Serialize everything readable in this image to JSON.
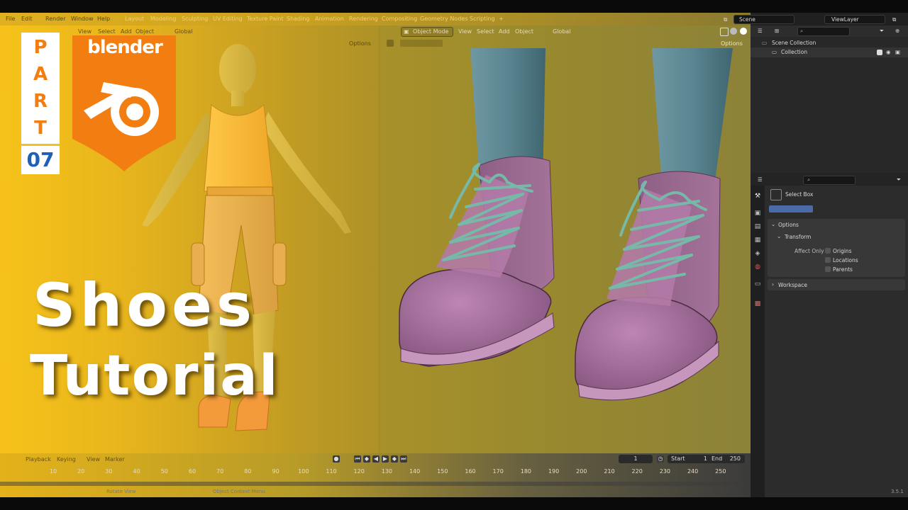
{
  "topbar": {
    "workspaces": [
      "Layout",
      "Modeling",
      "Sculpting",
      "UV Editing",
      "Texture Paint",
      "Shading",
      "Animation",
      "Rendering",
      "Compositing",
      "Geometry Nodes",
      "Scripting"
    ],
    "add_tab": "+",
    "menus_left": [
      "File",
      "Edit",
      "Render",
      "Window",
      "Help"
    ],
    "scene": "Scene",
    "view_layer": "ViewLayer"
  },
  "left_viewport": {
    "menus": [
      "View",
      "Select",
      "Add",
      "Object"
    ],
    "orientation": "Global",
    "options": "Options"
  },
  "right_viewport": {
    "mode": "Object Mode",
    "menus": [
      "View",
      "Select",
      "Add",
      "Object"
    ],
    "orientation": "Global",
    "options": "Options"
  },
  "thumbnail": {
    "part_letters": [
      "P",
      "A",
      "R",
      "T"
    ],
    "part_number": "07",
    "logo_text": "blender",
    "title_line1": "Shoes",
    "title_line2": "Tutorial"
  },
  "outliner": {
    "root": "Scene Collection",
    "items": [
      {
        "label": "Collection"
      }
    ]
  },
  "properties": {
    "tool_name": "Select Box",
    "options_label": "Options",
    "transform_label": "Transform",
    "affect_only_label": "Affect Only",
    "affect_options": [
      "Origins",
      "Locations",
      "Parents"
    ],
    "workspace_label": "Workspace"
  },
  "timeline": {
    "menus": [
      "Playback",
      "Keying",
      "View",
      "Marker"
    ],
    "current_frame": "1",
    "start_label": "Start",
    "start_value": "1",
    "end_label": "End",
    "end_value": "250",
    "ticks": [
      "10",
      "20",
      "30",
      "40",
      "50",
      "60",
      "70",
      "80",
      "90",
      "100",
      "110",
      "120",
      "130",
      "140",
      "150",
      "160",
      "170",
      "180",
      "190",
      "200",
      "210",
      "220",
      "230",
      "240",
      "250"
    ]
  },
  "statusbar": {
    "left": "Rotate View",
    "mid": "Object Context Menu",
    "version": "3.5.1"
  },
  "colors": {
    "orange": "#f27d10",
    "blue_num": "#1f5fb8",
    "shoe_pink": "#a06a96",
    "laces": "#6fb0a0",
    "jeans": "#5e8794"
  }
}
